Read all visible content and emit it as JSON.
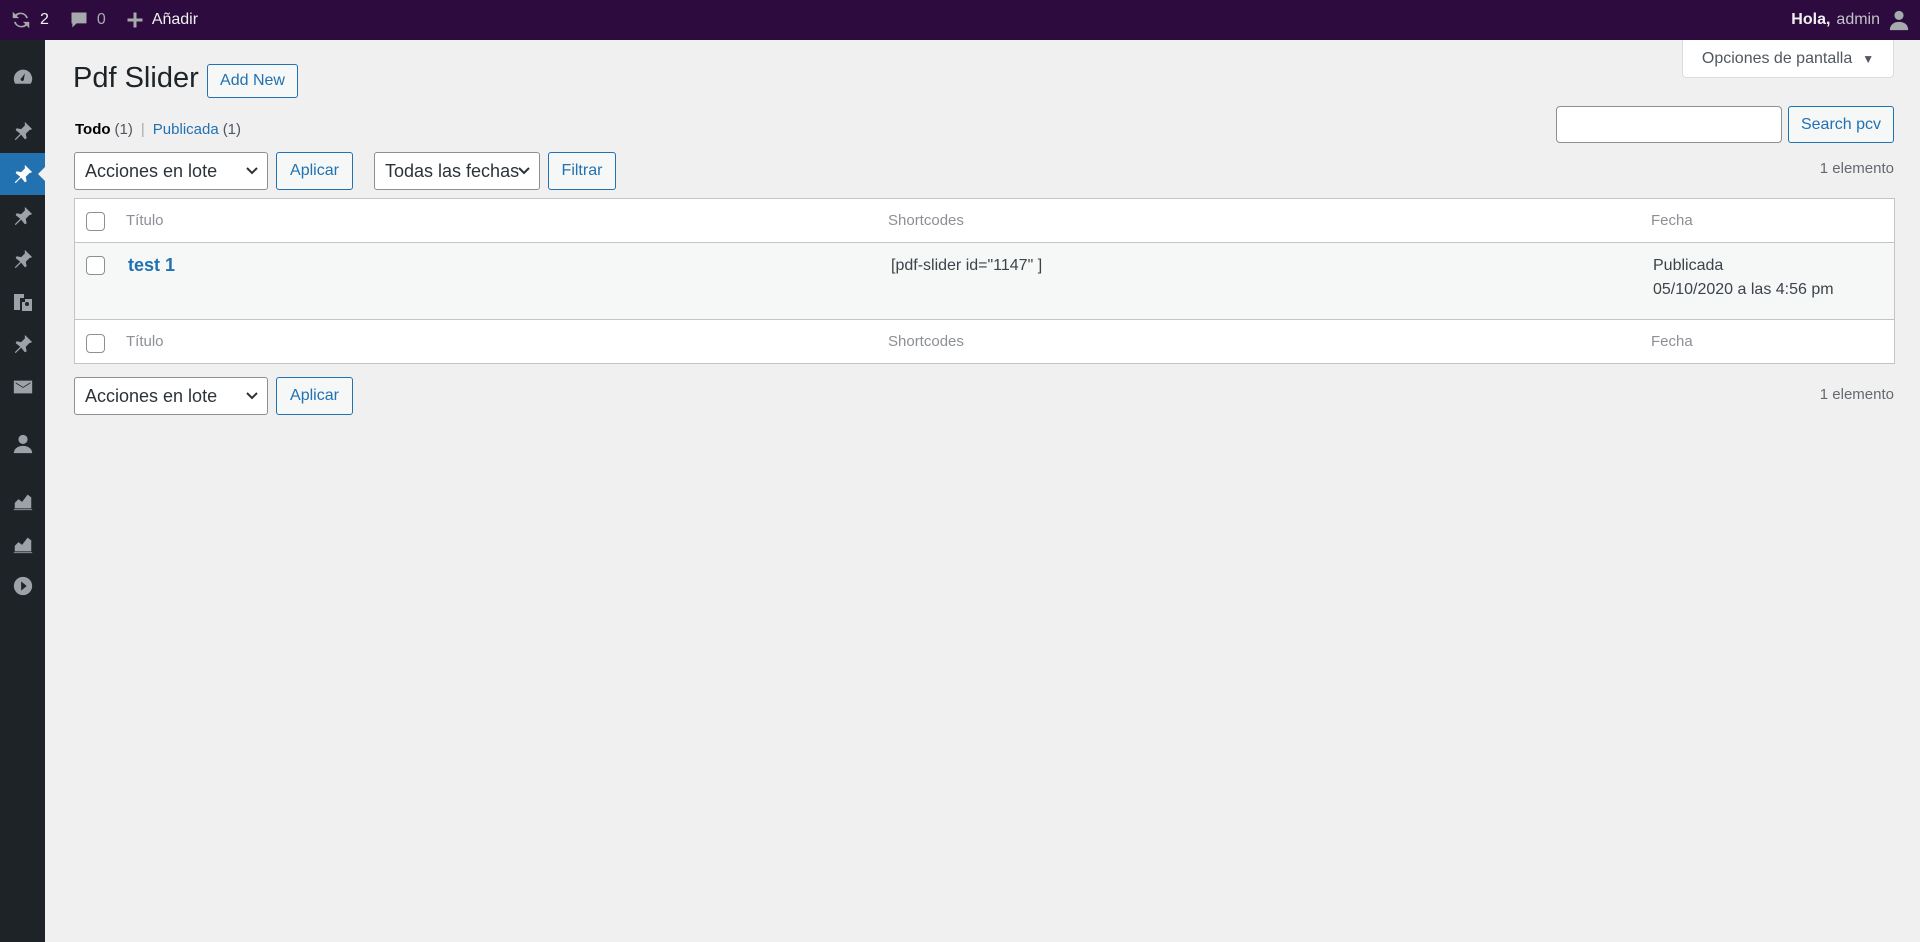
{
  "adminbar": {
    "updates_count": "2",
    "comments_count": "0",
    "add_label": "Añadir",
    "greeting": "Hola,",
    "username": "admin"
  },
  "sidebar": {
    "icons": [
      "dashboard-icon",
      "pin-icon",
      "pin-icon-active",
      "pin-icon",
      "pin-icon",
      "media-icon",
      "pin-icon",
      "mail-icon",
      "user-icon",
      "chart-icon",
      "chart-icon",
      "play-icon"
    ]
  },
  "screen_options": {
    "label": "Opciones de pantalla"
  },
  "page": {
    "title": "Pdf Slider",
    "add_new": "Add New"
  },
  "filters": {
    "all_label": "Todo",
    "all_count": "(1)",
    "separator": "|",
    "published_label": "Publicada",
    "published_count": "(1)"
  },
  "search": {
    "value": "",
    "button": "Search pcv"
  },
  "tablenav_top": {
    "bulk_selected": "Acciones en lote",
    "apply": "Aplicar",
    "dates_selected": "Todas las fechas",
    "filter": "Filtrar",
    "count": "1 elemento"
  },
  "table": {
    "columns": [
      "Título",
      "Shortcodes",
      "Fecha"
    ],
    "rows": [
      {
        "title": "test 1",
        "shortcode": "[pdf-slider id=\"1147\" ]",
        "status": "Publicada",
        "date": "05/10/2020 a las 4:56 pm"
      }
    ]
  },
  "tablenav_bottom": {
    "bulk_selected": "Acciones en lote",
    "apply": "Aplicar",
    "count": "1 elemento"
  },
  "colors": {
    "adminbar": "#2d0b3f",
    "sidebar": "#1d2327",
    "accent": "#2271b1",
    "background": "#f0f0f1"
  }
}
